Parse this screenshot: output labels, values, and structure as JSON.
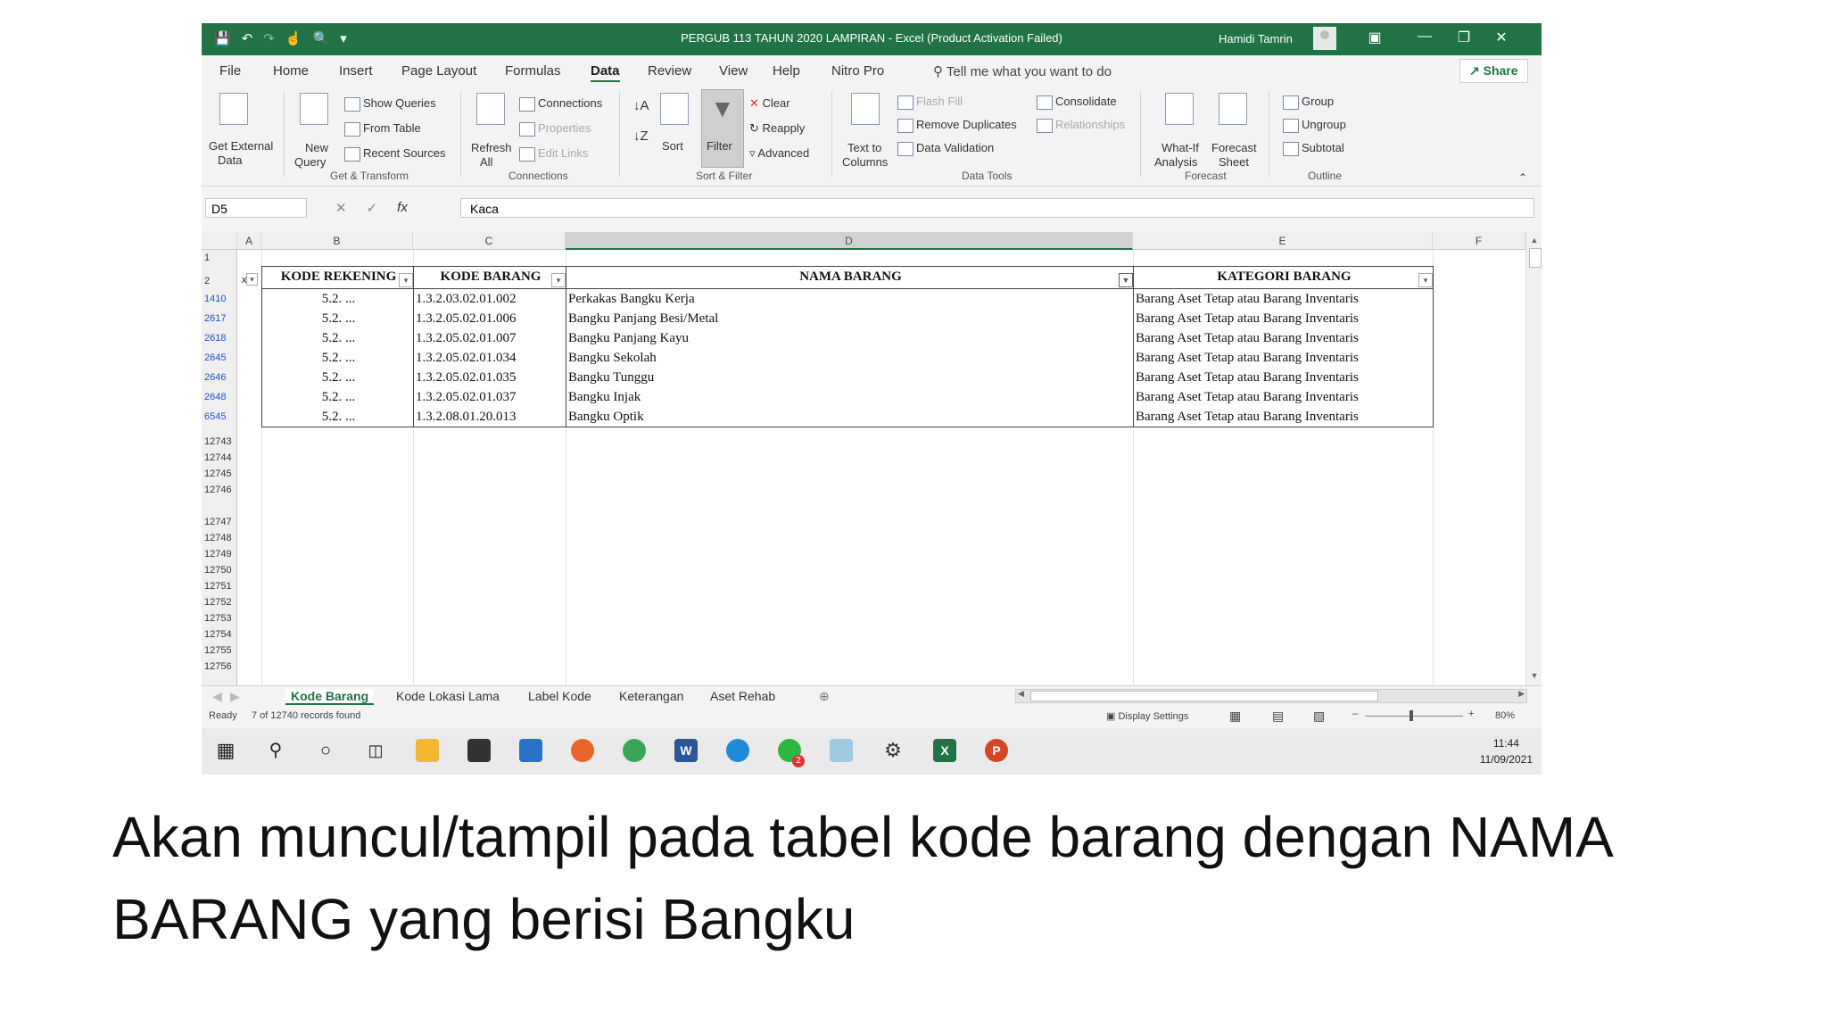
{
  "window": {
    "title": "PERGUB 113 TAHUN 2020 LAMPIRAN  -  Excel (Product Activation Failed)",
    "user": "Hamidi Tamrin"
  },
  "tabs": [
    "File",
    "Home",
    "Insert",
    "Page Layout",
    "Formulas",
    "Data",
    "Review",
    "View",
    "Help",
    "Nitro Pro"
  ],
  "active_tab": "Data",
  "tell_me": "Tell me what you want to do",
  "share": "Share",
  "ribbon": {
    "get_external": "Get External",
    "get_external_2": "Data",
    "new_query": "New",
    "new_query_2": "Query",
    "show_queries": "Show Queries",
    "from_table": "From Table",
    "recent_sources": "Recent Sources",
    "group_get_transform": "Get & Transform",
    "refresh": "Refresh",
    "refresh_2": "All",
    "connections": "Connections",
    "properties": "Properties",
    "edit_links": "Edit Links",
    "group_connections": "Connections",
    "sort": "Sort",
    "filter": "Filter",
    "clear": "Clear",
    "reapply": "Reapply",
    "advanced": "Advanced",
    "group_sort_filter": "Sort & Filter",
    "text_to": "Text to",
    "columns": "Columns",
    "flash_fill": "Flash Fill",
    "remove_duplicates": "Remove Duplicates",
    "data_validation": "Data Validation",
    "consolidate": "Consolidate",
    "relationships": "Relationships",
    "group_data_tools": "Data Tools",
    "what_if": "What-If",
    "analysis": "Analysis",
    "forecast": "Forecast",
    "sheet": "Sheet",
    "group_forecast": "Forecast",
    "group": "Group",
    "ungroup": "Ungroup",
    "subtotal": "Subtotal",
    "group_outline": "Outline"
  },
  "formula_bar": {
    "name_box": "D5",
    "value": "Kaca"
  },
  "columns": [
    "A",
    "B",
    "C",
    "D",
    "E",
    "F"
  ],
  "table": {
    "headers": [
      "KODE REKENING",
      "KODE BARANG",
      "NAMA BARANG",
      "KATEGORI BARANG"
    ],
    "row_header_1": "1",
    "row_header_2": "2",
    "a2_marker": "x",
    "rows": [
      {
        "row": "1410",
        "kode_rekening": "5.2. ...",
        "kode_barang": "1.3.2.03.02.01.002",
        "nama": "Perkakas Bangku Kerja",
        "kategori": "Barang Aset Tetap atau Barang Inventaris"
      },
      {
        "row": "2617",
        "kode_rekening": "5.2. ...",
        "kode_barang": "1.3.2.05.02.01.006",
        "nama": "Bangku Panjang Besi/Metal",
        "kategori": "Barang Aset Tetap atau Barang Inventaris"
      },
      {
        "row": "2618",
        "kode_rekening": "5.2. ...",
        "kode_barang": "1.3.2.05.02.01.007",
        "nama": "Bangku Panjang Kayu",
        "kategori": "Barang Aset Tetap atau Barang Inventaris"
      },
      {
        "row": "2645",
        "kode_rekening": "5.2. ...",
        "kode_barang": "1.3.2.05.02.01.034",
        "nama": "Bangku Sekolah",
        "kategori": "Barang Aset Tetap atau Barang Inventaris"
      },
      {
        "row": "2646",
        "kode_rekening": "5.2. ...",
        "kode_barang": "1.3.2.05.02.01.035",
        "nama": "Bangku Tunggu",
        "kategori": "Barang Aset Tetap atau Barang Inventaris"
      },
      {
        "row": "2648",
        "kode_rekening": "5.2. ...",
        "kode_barang": "1.3.2.05.02.01.037",
        "nama": "Bangku Injak",
        "kategori": "Barang Aset Tetap atau Barang Inventaris"
      },
      {
        "row": "6545",
        "kode_rekening": "5.2. ...",
        "kode_barang": "1.3.2.08.01.20.013",
        "nama": "Bangku Optik",
        "kategori": "Barang Aset Tetap atau Barang Inventaris"
      }
    ],
    "extra_rows": [
      "12743",
      "12744",
      "12745",
      "12746",
      "12747",
      "12748",
      "12749",
      "12750",
      "12751",
      "12752",
      "12753",
      "12754",
      "12755",
      "12756"
    ]
  },
  "sheet_tabs": [
    "Kode Barang",
    "Kode Lokasi Lama",
    "Label Kode",
    "Keterangan",
    "Aset Rehab"
  ],
  "active_sheet": "Kode Barang",
  "status": {
    "ready": "Ready",
    "records": "7 of 12740 records found",
    "display_settings": "Display Settings",
    "zoom": "80%"
  },
  "taskbar": {
    "time": "11:44",
    "date": "11/09/2021",
    "badge": "2"
  },
  "caption": "Akan muncul/tampil pada tabel kode barang dengan NAMA BARANG yang berisi Bangku"
}
